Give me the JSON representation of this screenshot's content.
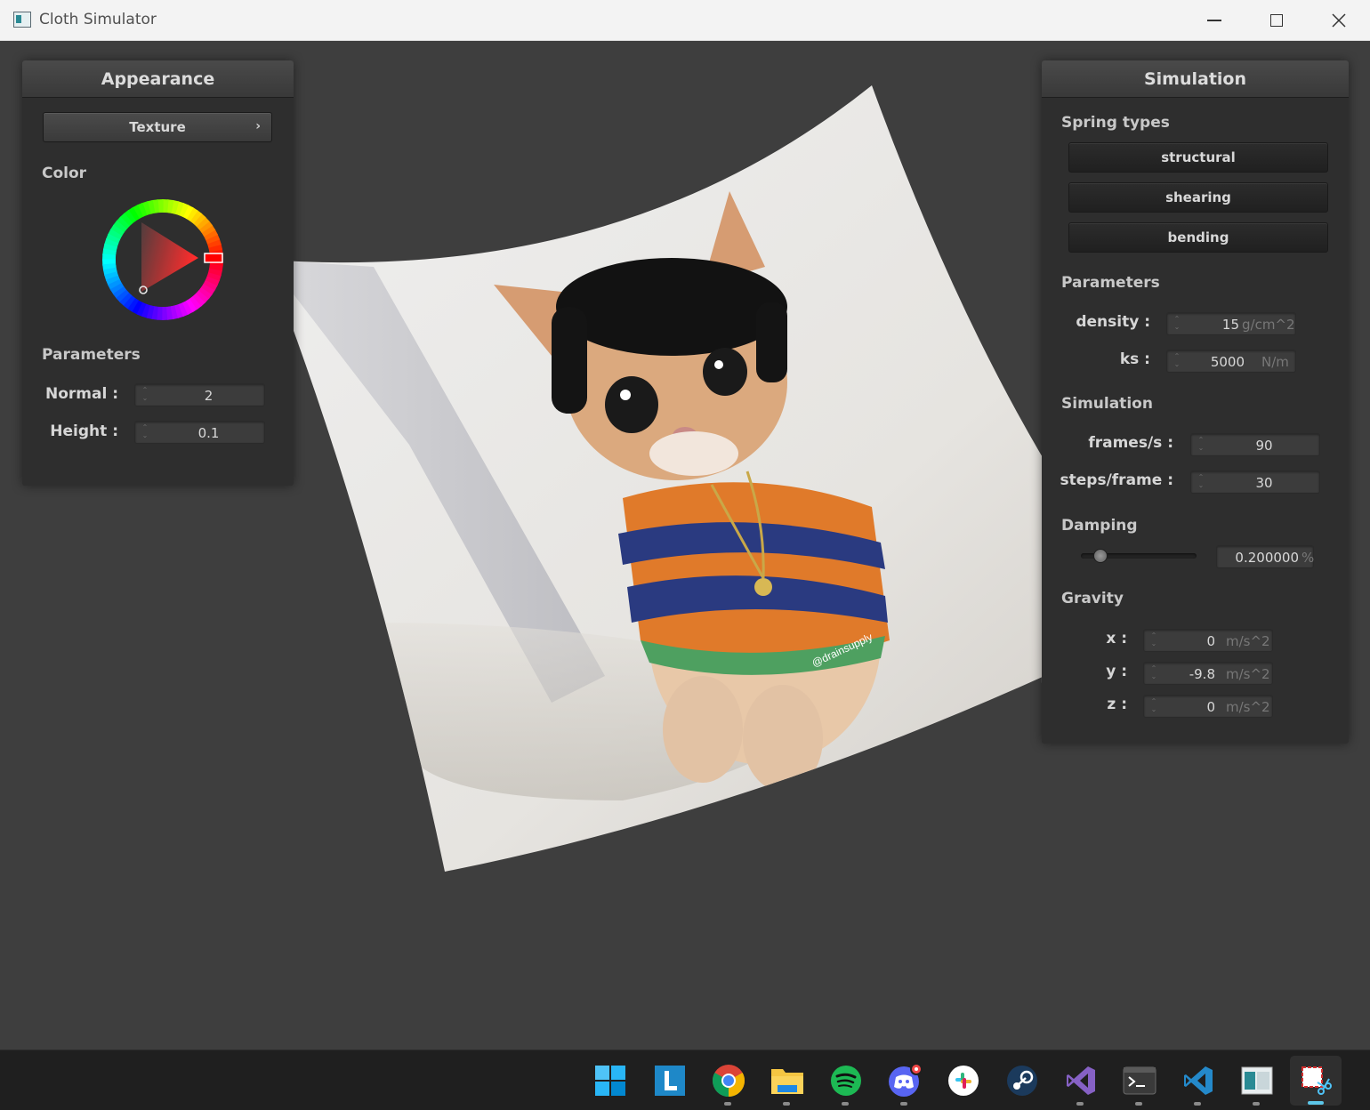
{
  "window": {
    "title": "Cloth Simulator"
  },
  "appearance": {
    "header": "Appearance",
    "texture_button": "Texture",
    "color_label": "Color",
    "selected_color": "#ff0000",
    "parameters_label": "Parameters",
    "normal_label": "Normal :",
    "normal_value": "2",
    "height_label": "Height :",
    "height_value": "0.1"
  },
  "simulation": {
    "header": "Simulation",
    "spring_types_label": "Spring types",
    "spring_buttons": [
      "structural",
      "shearing",
      "bending"
    ],
    "parameters_label": "Parameters",
    "density_label": "density :",
    "density_value": "15",
    "density_unit": "g/cm^2",
    "ks_label": "ks :",
    "ks_value": "5000",
    "ks_unit": "N/m",
    "simulation_label": "Simulation",
    "fps_label": "frames/s :",
    "fps_value": "90",
    "steps_label": "steps/frame :",
    "steps_value": "30",
    "damping_label": "Damping",
    "damping_value": "0.200000",
    "damping_unit": "%",
    "damping_level": 0.2,
    "gravity_label": "Gravity",
    "gx_label": "x :",
    "gx_value": "0",
    "gy_label": "y :",
    "gy_value": "-9.8",
    "gz_label": "z :",
    "gz_value": "0",
    "gravity_unit": "m/s^2"
  },
  "cloth_watermark": "@drainsupply",
  "taskbar": {
    "apps": [
      "windows-start-icon",
      "libby-icon",
      "chrome-icon",
      "file-explorer-icon",
      "spotify-icon",
      "discord-icon",
      "slack-icon",
      "steam-icon",
      "visual-studio-icon",
      "terminal-icon",
      "vscode-icon",
      "window-app-icon",
      "snipping-tool-icon"
    ]
  }
}
